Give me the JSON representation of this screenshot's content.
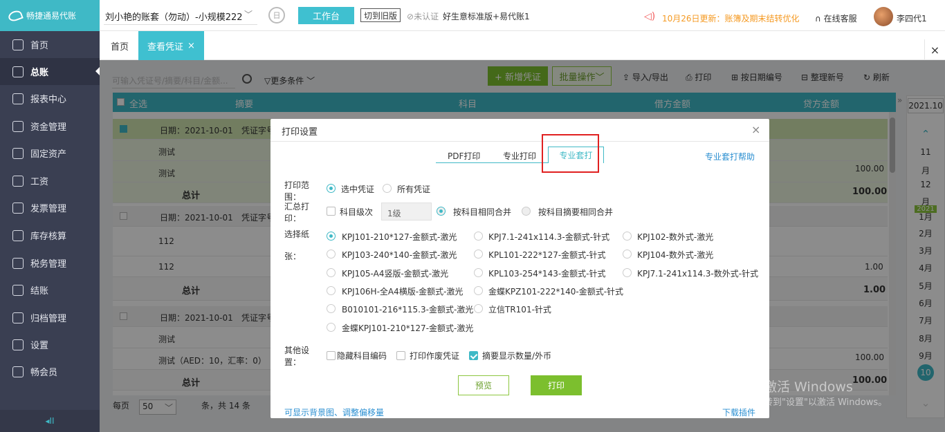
{
  "header": {
    "logo_text": "畅捷通易代账",
    "account": "刘小艳的账套（勿动）-小规模222",
    "workbench": "工作台",
    "old_version": "切到旧版",
    "certification": "未认证",
    "version": "好生意标准版+易代账1",
    "notice": "10月26日更新：账簿及期末结转优化",
    "service": "在线客服",
    "user": "李四代1"
  },
  "sidebar": {
    "items": [
      {
        "label": "首页",
        "icon": "home-icon"
      },
      {
        "label": "总账",
        "icon": "ledger-icon"
      },
      {
        "label": "报表中心",
        "icon": "report-icon"
      },
      {
        "label": "资金管理",
        "icon": "fund-icon"
      },
      {
        "label": "固定资产",
        "icon": "asset-icon"
      },
      {
        "label": "工资",
        "icon": "salary-icon"
      },
      {
        "label": "发票管理",
        "icon": "invoice-icon"
      },
      {
        "label": "库存核算",
        "icon": "inventory-icon"
      },
      {
        "label": "税务管理",
        "icon": "tax-icon"
      },
      {
        "label": "结账",
        "icon": "close-book-icon"
      },
      {
        "label": "归档管理",
        "icon": "archive-icon"
      },
      {
        "label": "设置",
        "icon": "gear-icon"
      },
      {
        "label": "畅会员",
        "icon": "vip-icon"
      }
    ],
    "collapse": "◂II"
  },
  "tabs": {
    "home": "首页",
    "view": "查看凭证",
    "close": "×",
    "close_all": "×"
  },
  "toolbar": {
    "search_placeholder": "可输入凭证号/摘要/科目/金额...",
    "more": "更多条件",
    "new": "+ 新增凭证",
    "batch": "批量操作",
    "import_export": "导入/导出",
    "print": "打印",
    "date_number": "按日期编号",
    "renumber": "整理新号",
    "refresh": "刷新"
  },
  "grid": {
    "headers": [
      "全选",
      "摘要",
      "科目",
      "借方金额",
      "贷方金额"
    ],
    "vouchers": [
      {
        "date": "日期：2021-10-01",
        "vno": "凭证字号",
        "rows": [
          "测试",
          "测试"
        ],
        "amount": "100.00",
        "total_label": "总计",
        "total": "100.00"
      },
      {
        "date": "日期：2021-10-01",
        "vno": "凭证字号",
        "rows": [
          "112",
          "112"
        ],
        "amount": "1.00",
        "total_label": "总计",
        "total": "1.00"
      },
      {
        "date": "日期：2021-10-01",
        "vno": "凭证字号",
        "rows": [
          "测试",
          "测试（AED：10，汇率：0）"
        ],
        "amount": "100.00",
        "total_label": "总计",
        "total": "100.00"
      }
    ]
  },
  "pager": {
    "per_page": "每页",
    "size": "50",
    "summary": "条，共 14 条"
  },
  "calendar": {
    "year_label": "2021.10",
    "months_before": [
      "11",
      "月",
      "12",
      "月"
    ],
    "year_badge": "2021",
    "months": [
      "1月",
      "2月",
      "3月",
      "4月",
      "5月",
      "6月",
      "7月",
      "8月",
      "9月"
    ],
    "current": "10"
  },
  "dialog": {
    "title": "打印设置",
    "close": "×",
    "tabs": [
      "PDF打印",
      "专业打印",
      "专业套打"
    ],
    "help": "专业套打帮助",
    "range_label_1": "打印范",
    "range_label_2": "围：",
    "range_options": [
      "选中凭证",
      "所有凭证"
    ],
    "summary_label_1": "汇总打",
    "summary_label_2": "印：",
    "subject_level": "科目级次",
    "level_value": "1级",
    "merge_options": [
      "按科目相同合并",
      "按科目摘要相同合并"
    ],
    "paper_label_1": "选择纸",
    "paper_label_2": "张：",
    "papers": [
      "KPJ101-210*127-金额式-激光",
      "KPJ7.1-241x114.3-金额式-针式",
      "KPJ102-数外式-激光",
      "KPJ103-240*140-金额式-激光",
      "KPL101-222*127-金额式-针式",
      "KPJ104-数外式-激光",
      "KPJ105-A4竖版-金额式-激光",
      "KPL103-254*143-金额式-针式",
      "KPJ7.1-241x114.3-数外式-针式",
      "KPJ106H-全A4横版-金额式-激光",
      "金蝶KPZ101-222*140-金额式-针式",
      "B010101-216*115.3-金额式-激光",
      "立信TR101-针式",
      "金蝶KPJ101-210*127-金额式-激光"
    ],
    "other_label_1": "其他设",
    "other_label_2": "置：",
    "other_options": [
      "隐藏科目编码",
      "打印作废凭证",
      "摘要显示数量/外币"
    ],
    "preview": "预览",
    "print": "打印",
    "link_left": "可显示背景图、调整偏移量",
    "link_right": "下载插件"
  },
  "watermark": {
    "line1": "激活 Windows",
    "line2": "转到\"设置\"以激活 Windows。"
  },
  "colors": {
    "brand": "#3fb9c6",
    "green": "#7cbf2e",
    "sidebar": "#3a3f52",
    "highlight": "#e02020"
  }
}
